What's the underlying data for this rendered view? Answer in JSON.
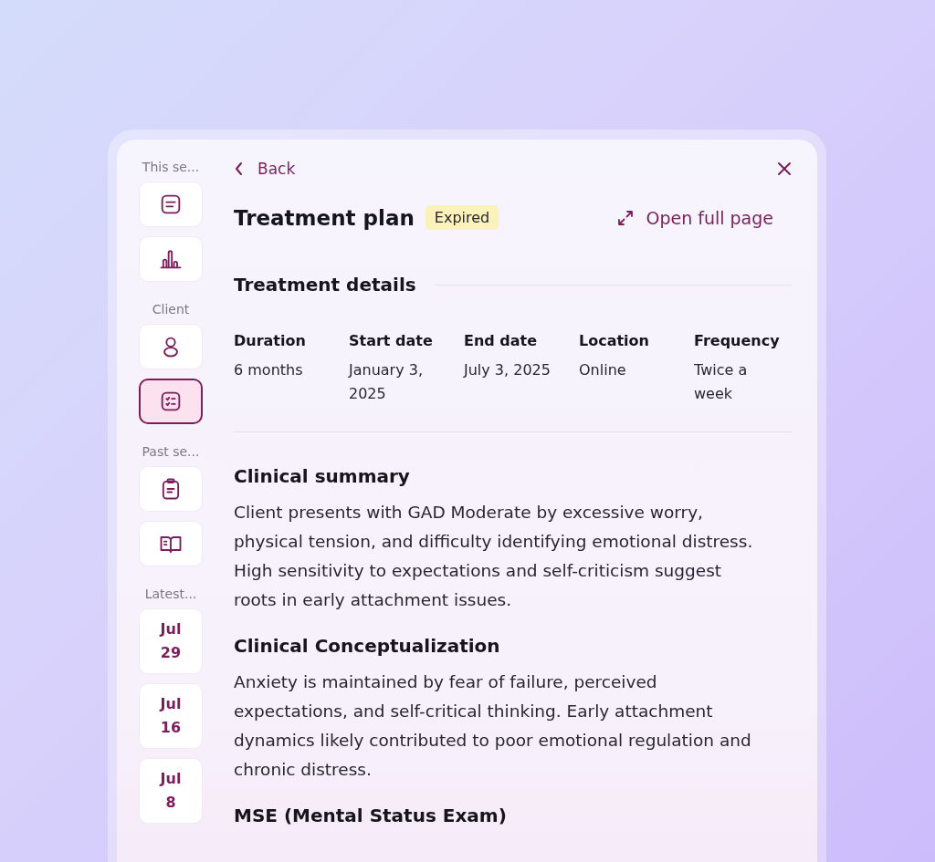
{
  "sidebar": {
    "groups": [
      {
        "label": "This se...",
        "items": [
          {
            "kind": "icon",
            "selected": false
          },
          {
            "kind": "icon",
            "selected": false
          }
        ]
      },
      {
        "label": "Client",
        "items": [
          {
            "kind": "icon",
            "selected": false
          },
          {
            "kind": "icon",
            "selected": true
          }
        ]
      },
      {
        "label": "Past se...",
        "items": [
          {
            "kind": "icon",
            "selected": false
          },
          {
            "kind": "icon",
            "selected": false
          }
        ]
      },
      {
        "label": "Latest...",
        "items": [
          {
            "kind": "date",
            "month": "Jul",
            "day": "29",
            "selected": false
          },
          {
            "kind": "date",
            "month": "Jul",
            "day": "16",
            "selected": false
          },
          {
            "kind": "date",
            "month": "Jul",
            "day": "8",
            "selected": false
          }
        ]
      }
    ]
  },
  "header": {
    "back": "Back",
    "title": "Treatment plan",
    "status": "Expired",
    "open_full_page": "Open full page"
  },
  "details": {
    "title": "Treatment details",
    "fields": [
      {
        "label": "Duration",
        "value": "6 months"
      },
      {
        "label": "Start date",
        "value": "January 3, 2025"
      },
      {
        "label": "End date",
        "value": "July 3, 2025"
      },
      {
        "label": "Location",
        "value": "Online"
      },
      {
        "label": "Frequency",
        "value": "Twice a week"
      }
    ]
  },
  "sections": [
    {
      "title": "Clinical summary",
      "body": "Client presents with GAD Moderate by excessive worry, physical tension, and difficulty identifying emotional distress. High sensitivity to expectations and self-criticism suggest roots in early attachment issues."
    },
    {
      "title": "Clinical Conceptualization",
      "body": "Anxiety is maintained by fear of failure, perceived expectations, and self-critical thinking. Early attachment dynamics likely contributed to poor emotional regulation and chronic distress."
    },
    {
      "title": "MSE (Mental Status Exam)"
    }
  ]
}
